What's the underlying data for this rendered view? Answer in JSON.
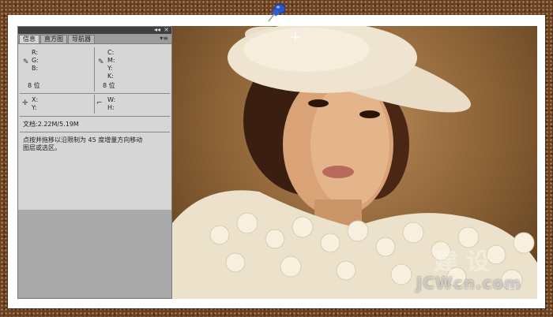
{
  "panel": {
    "tabs": [
      "信息",
      "直方图",
      "导航器"
    ],
    "controls": {
      "collapse": "◂◂",
      "close": "×",
      "menu": "▾≡"
    },
    "rgb": {
      "r": "R:",
      "g": "G:",
      "b": "B:",
      "bits": "8 位"
    },
    "cmyk": {
      "c": "C:",
      "m": "M:",
      "y": "Y:",
      "k": "K:",
      "bits": "8 位"
    },
    "xy": {
      "x": "X:",
      "y": "Y:"
    },
    "wh": {
      "w": "W:",
      "h": "H:"
    },
    "doc": "文档:2.22M/5.19M",
    "hint_line1": "点按并拖移以沿限制为 45 度增量方向移动",
    "hint_line2": "图层或选区。"
  },
  "watermark": {
    "site": "JCWcn.com",
    "cn": "建 设"
  },
  "colors": {
    "background": "#6a4324",
    "frame": "#ffffff",
    "pin": "#2a54c8",
    "panel": "#d6d6d6"
  },
  "icons": {
    "pin": "pushpin-icon",
    "eyedropper": "eyedropper-icon",
    "crosshair": "crosshair-icon",
    "selection": "selection-size-icon"
  }
}
